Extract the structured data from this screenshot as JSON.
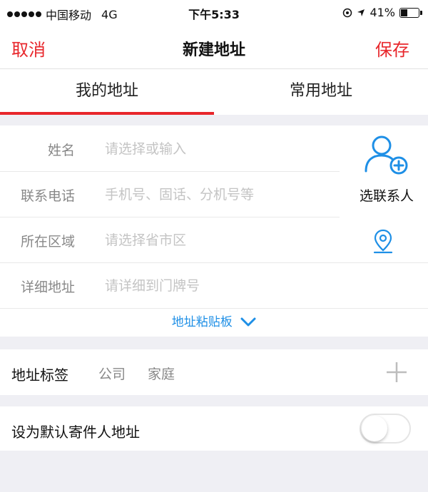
{
  "status_bar": {
    "carrier": "中国移动",
    "network": "4G",
    "time": "下午5:33",
    "battery_percent": "41%",
    "battery_level": 0.41
  },
  "nav": {
    "cancel_label": "取消",
    "title": "新建地址",
    "save_label": "保存",
    "accent_color": "#e8262b"
  },
  "tabs": [
    {
      "label": "我的地址",
      "active": true
    },
    {
      "label": "常用地址",
      "active": false
    }
  ],
  "form": {
    "name": {
      "label": "姓名",
      "value": "",
      "placeholder": "请选择或输入"
    },
    "phone": {
      "label": "联系电话",
      "value": "",
      "placeholder": "手机号、固话、分机号等"
    },
    "region": {
      "label": "所在区域",
      "value": "",
      "placeholder": "请选择省市区"
    },
    "detail": {
      "label": "详细地址",
      "value": "",
      "placeholder": "请详细到门牌号"
    },
    "contact_button_label": "选联系人",
    "clipboard_label": "地址粘贴板",
    "link_color": "#1e8fe6"
  },
  "tags": {
    "label": "地址标签",
    "options": [
      "公司",
      "家庭"
    ]
  },
  "default_sender": {
    "label": "设为默认寄件人地址",
    "enabled": false
  }
}
